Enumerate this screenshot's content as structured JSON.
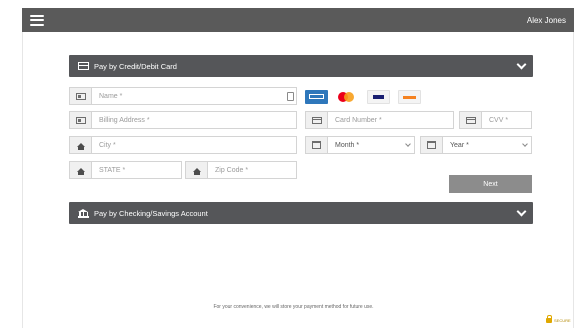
{
  "header": {
    "user_name": "Alex Jones"
  },
  "credit_section": {
    "title": "Pay by Credit/Debit Card",
    "fields": {
      "name": "Name *",
      "billing_address": "Billing Address *",
      "city": "City *",
      "state": "STATE *",
      "zip": "Zip Code *",
      "card_number": "Card Number *",
      "cvv": "CVV *",
      "month": "Month *",
      "year": "Year *"
    },
    "card_logos": [
      "amex",
      "mastercard",
      "visa",
      "discover"
    ],
    "next_label": "Next"
  },
  "checking_section": {
    "title": "Pay by Checking/Savings Account"
  },
  "footer": {
    "note": "For your convenience, we will store your payment method for future use.",
    "secure_label": "SECURE"
  },
  "colors": {
    "header_bg": "#5a5a5a",
    "section_bg": "#555659",
    "next_bg": "#8c8c8c",
    "amex": "#2e77bb",
    "mastercard_red": "#eb001b",
    "mastercard_orange": "#f79e1b",
    "visa": "#1a1f71"
  }
}
